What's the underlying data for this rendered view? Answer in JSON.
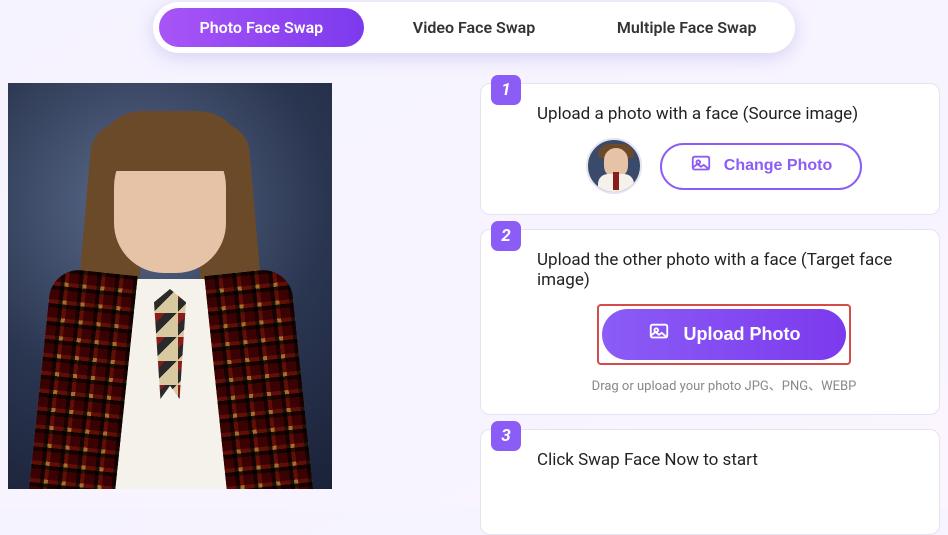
{
  "tabs": {
    "photo": "Photo Face Swap",
    "video": "Video Face Swap",
    "multiple": "Multiple Face Swap"
  },
  "steps": {
    "one": {
      "num": "1",
      "title": "Upload a photo with a face (Source image)",
      "change_label": "Change Photo"
    },
    "two": {
      "num": "2",
      "title": "Upload the other photo with a face (Target face image)",
      "upload_label": "Upload Photo",
      "helper": "Drag or upload your photo  JPG、PNG、WEBP"
    },
    "three": {
      "num": "3",
      "title": "Click Swap Face Now to start"
    }
  }
}
